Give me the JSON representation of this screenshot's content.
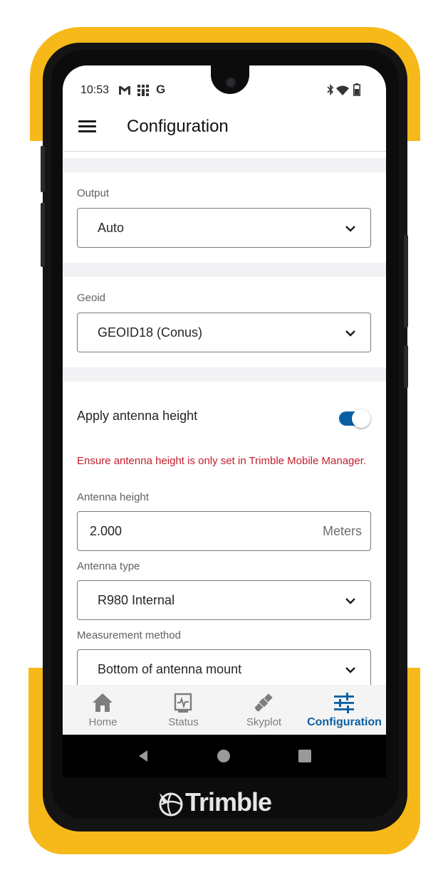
{
  "device": {
    "brand": "Trimble",
    "bumper_color": "#f7b919",
    "accent_color": "#0a5fa3",
    "warning_color": "#c31e2c"
  },
  "status_bar": {
    "time": "10:53",
    "left_icons": [
      "gmail-icon",
      "grid-icon",
      "google-icon"
    ],
    "right_icons": [
      "bluetooth-icon",
      "wifi-icon",
      "battery-icon"
    ]
  },
  "app_bar": {
    "title": "Configuration"
  },
  "output": {
    "label": "Output",
    "value": "Auto"
  },
  "geoid": {
    "label": "Geoid",
    "value": "GEOID18 (Conus)"
  },
  "apply_antenna_height": {
    "label": "Apply antenna height",
    "enabled": true
  },
  "warning_text": "Ensure antenna height is only set in Trimble Mobile Manager.",
  "antenna_height": {
    "label": "Antenna height",
    "value": "2.000",
    "unit": "Meters"
  },
  "antenna_type": {
    "label": "Antenna type",
    "value": "R980 Internal"
  },
  "measurement_method": {
    "label": "Measurement method",
    "value": "Bottom of antenna mount"
  },
  "bottom_nav": {
    "items": [
      {
        "label": "Home",
        "icon": "home-icon",
        "active": false
      },
      {
        "label": "Status",
        "icon": "status-icon",
        "active": false
      },
      {
        "label": "Skyplot",
        "icon": "satellite-icon",
        "active": false
      },
      {
        "label": "Configuration",
        "icon": "sliders-icon",
        "active": true
      }
    ]
  }
}
